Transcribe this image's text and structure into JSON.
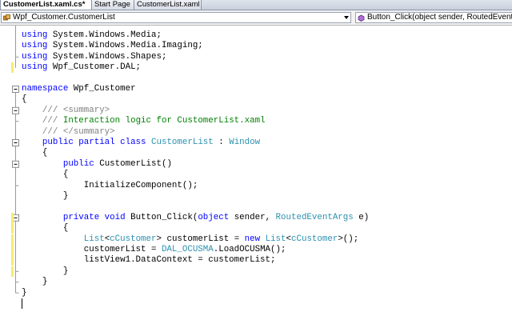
{
  "tabs": [
    {
      "label": "CustomerList.xaml.cs*",
      "active": true
    },
    {
      "label": "Start Page",
      "active": false
    },
    {
      "label": "CustomerList.xaml",
      "active": false
    }
  ],
  "navbar": {
    "class_selector": "Wpf_Customer.CustomerList",
    "member_selector": "Button_Click(object sender, RoutedEventA",
    "dropdown_icon": "chevron-down-icon"
  },
  "colors": {
    "keyword": "#0000ff",
    "type": "#2b91af",
    "comment": "#008000",
    "doc_tag": "#808080",
    "changed_line_marker": "#f6ec72"
  },
  "code_lines": [
    {
      "changed": false,
      "tokens": [
        {
          "t": "kw",
          "v": "using"
        },
        {
          "t": "n",
          "v": " System.Windows.Media;"
        }
      ]
    },
    {
      "changed": false,
      "tokens": [
        {
          "t": "kw",
          "v": "using"
        },
        {
          "t": "n",
          "v": " System.Windows.Media.Imaging;"
        }
      ]
    },
    {
      "changed": false,
      "tokens": [
        {
          "t": "kw",
          "v": "using"
        },
        {
          "t": "n",
          "v": " System.Windows.Shapes;"
        }
      ]
    },
    {
      "changed": true,
      "tokens": [
        {
          "t": "kw",
          "v": "using"
        },
        {
          "t": "n",
          "v": " Wpf_Customer.DAL;"
        }
      ]
    },
    {
      "changed": false,
      "tokens": []
    },
    {
      "changed": false,
      "tokens": [
        {
          "t": "kw",
          "v": "namespace"
        },
        {
          "t": "n",
          "v": " Wpf_Customer"
        }
      ]
    },
    {
      "changed": false,
      "tokens": [
        {
          "t": "n",
          "v": "{"
        }
      ]
    },
    {
      "changed": false,
      "tokens": [
        {
          "t": "n",
          "v": "    "
        },
        {
          "t": "dc",
          "v": "/// "
        },
        {
          "t": "dc",
          "v": "<summary>"
        }
      ]
    },
    {
      "changed": false,
      "tokens": [
        {
          "t": "n",
          "v": "    "
        },
        {
          "t": "dc",
          "v": "///"
        },
        {
          "t": "cm",
          "v": " Interaction logic for CustomerList.xaml"
        }
      ]
    },
    {
      "changed": false,
      "tokens": [
        {
          "t": "n",
          "v": "    "
        },
        {
          "t": "dc",
          "v": "/// "
        },
        {
          "t": "dc",
          "v": "</summary>"
        }
      ]
    },
    {
      "changed": false,
      "tokens": [
        {
          "t": "n",
          "v": "    "
        },
        {
          "t": "kw",
          "v": "public partial class"
        },
        {
          "t": "n",
          "v": " "
        },
        {
          "t": "ty",
          "v": "CustomerList"
        },
        {
          "t": "n",
          "v": " : "
        },
        {
          "t": "ty",
          "v": "Window"
        }
      ]
    },
    {
      "changed": false,
      "tokens": [
        {
          "t": "n",
          "v": "    {"
        }
      ]
    },
    {
      "changed": false,
      "tokens": [
        {
          "t": "n",
          "v": "        "
        },
        {
          "t": "kw",
          "v": "public"
        },
        {
          "t": "n",
          "v": " CustomerList()"
        }
      ]
    },
    {
      "changed": false,
      "tokens": [
        {
          "t": "n",
          "v": "        {"
        }
      ]
    },
    {
      "changed": false,
      "tokens": [
        {
          "t": "n",
          "v": "            InitializeComponent();"
        }
      ]
    },
    {
      "changed": false,
      "tokens": [
        {
          "t": "n",
          "v": "        }"
        }
      ]
    },
    {
      "changed": false,
      "tokens": []
    },
    {
      "changed": true,
      "tokens": [
        {
          "t": "n",
          "v": "        "
        },
        {
          "t": "kw",
          "v": "private void"
        },
        {
          "t": "n",
          "v": " Button_Click("
        },
        {
          "t": "kw",
          "v": "object"
        },
        {
          "t": "n",
          "v": " sender, "
        },
        {
          "t": "ty",
          "v": "RoutedEventArgs"
        },
        {
          "t": "n",
          "v": " e)"
        }
      ]
    },
    {
      "changed": true,
      "tokens": [
        {
          "t": "n",
          "v": "        {"
        }
      ]
    },
    {
      "changed": true,
      "tokens": [
        {
          "t": "n",
          "v": "            "
        },
        {
          "t": "ty",
          "v": "List"
        },
        {
          "t": "n",
          "v": "<"
        },
        {
          "t": "ty",
          "v": "cCustomer"
        },
        {
          "t": "n",
          "v": "> customerList = "
        },
        {
          "t": "kw",
          "v": "new"
        },
        {
          "t": "n",
          "v": " "
        },
        {
          "t": "ty",
          "v": "List"
        },
        {
          "t": "n",
          "v": "<"
        },
        {
          "t": "ty",
          "v": "cCustomer"
        },
        {
          "t": "n",
          "v": ">();"
        }
      ]
    },
    {
      "changed": true,
      "tokens": [
        {
          "t": "n",
          "v": "            customerList = "
        },
        {
          "t": "ty",
          "v": "DAL_OCUSMA"
        },
        {
          "t": "n",
          "v": ".LoadOCUSMA();"
        }
      ]
    },
    {
      "changed": true,
      "tokens": [
        {
          "t": "n",
          "v": "            listView1.DataContext = customerList;"
        }
      ]
    },
    {
      "changed": true,
      "tokens": [
        {
          "t": "n",
          "v": "        }"
        }
      ]
    },
    {
      "changed": false,
      "tokens": [
        {
          "t": "n",
          "v": "    }"
        }
      ]
    },
    {
      "changed": false,
      "tokens": [
        {
          "t": "n",
          "v": "}"
        }
      ]
    }
  ],
  "outline_toggles": [
    {
      "line": 5,
      "state": "minus"
    },
    {
      "line": 7,
      "state": "minus"
    },
    {
      "line": 10,
      "state": "minus"
    },
    {
      "line": 12,
      "state": "minus"
    },
    {
      "line": 17,
      "state": "minus"
    }
  ],
  "outline_ends": [
    3,
    9,
    15,
    23,
    24,
    25
  ]
}
